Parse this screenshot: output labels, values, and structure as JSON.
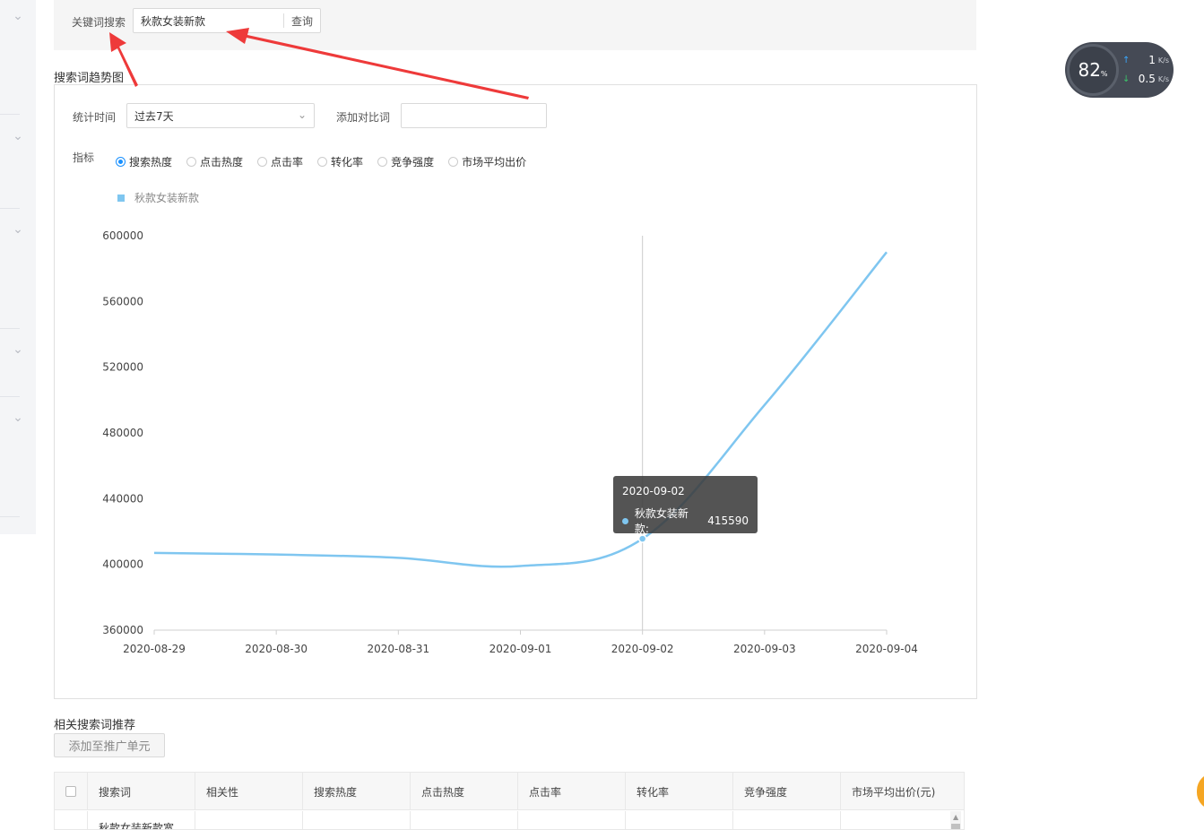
{
  "search": {
    "label": "关键词搜索",
    "value": "秋款女装新款",
    "button": "查询"
  },
  "trend": {
    "section_title": "搜索词趋势图",
    "period_label": "统计时间",
    "period_value": "过去7天",
    "compare_label": "添加对比词",
    "compare_value": "",
    "metric_label": "指标",
    "metrics": [
      {
        "label": "搜索热度",
        "checked": true
      },
      {
        "label": "点击热度",
        "checked": false
      },
      {
        "label": "点击率",
        "checked": false
      },
      {
        "label": "转化率",
        "checked": false
      },
      {
        "label": "竞争强度",
        "checked": false
      },
      {
        "label": "市场平均出价",
        "checked": false
      }
    ]
  },
  "colors": {
    "series": "#7fc6f0",
    "radio_active": "#1890ff",
    "annotation_arrow": "#ee3a3a"
  },
  "chart_data": {
    "type": "line",
    "x": [
      "2020-08-29",
      "2020-08-30",
      "2020-08-31",
      "2020-09-01",
      "2020-09-02",
      "2020-09-03",
      "2020-09-04"
    ],
    "series": [
      {
        "name": "秋款女装新款",
        "values": [
          407000,
          406000,
          404000,
          399000,
          415590,
          497000,
          590000
        ]
      }
    ],
    "ylim": [
      360000,
      600000
    ],
    "yticks": [
      "600000",
      "560000",
      "520000",
      "480000",
      "440000",
      "400000",
      "360000"
    ],
    "smooth": true,
    "grid": false,
    "legend_position": "top-left",
    "tooltip": {
      "date": "2020-09-02",
      "series_label": "秋款女装新款:",
      "value": "415590"
    }
  },
  "related": {
    "section_title": "相关搜索词推荐",
    "add_button": "添加至推广单元",
    "columns": [
      "搜索词",
      "相关性",
      "搜索热度",
      "点击热度",
      "点击率",
      "转化率",
      "竞争强度",
      "市场平均出价(元)"
    ],
    "rows": [
      {
        "keyword": "秋款女装新款宽"
      }
    ]
  },
  "speed_widget": {
    "percent": "82",
    "percent_sign": "%",
    "upload": "1",
    "download": "0.5",
    "unit": "K/s"
  },
  "icons": {
    "rail_chevron": "chevron-down-icon",
    "select_chevron": "chevron-down-icon",
    "upload_arrow": "arrow-up-icon",
    "download_arrow": "arrow-down-icon"
  }
}
